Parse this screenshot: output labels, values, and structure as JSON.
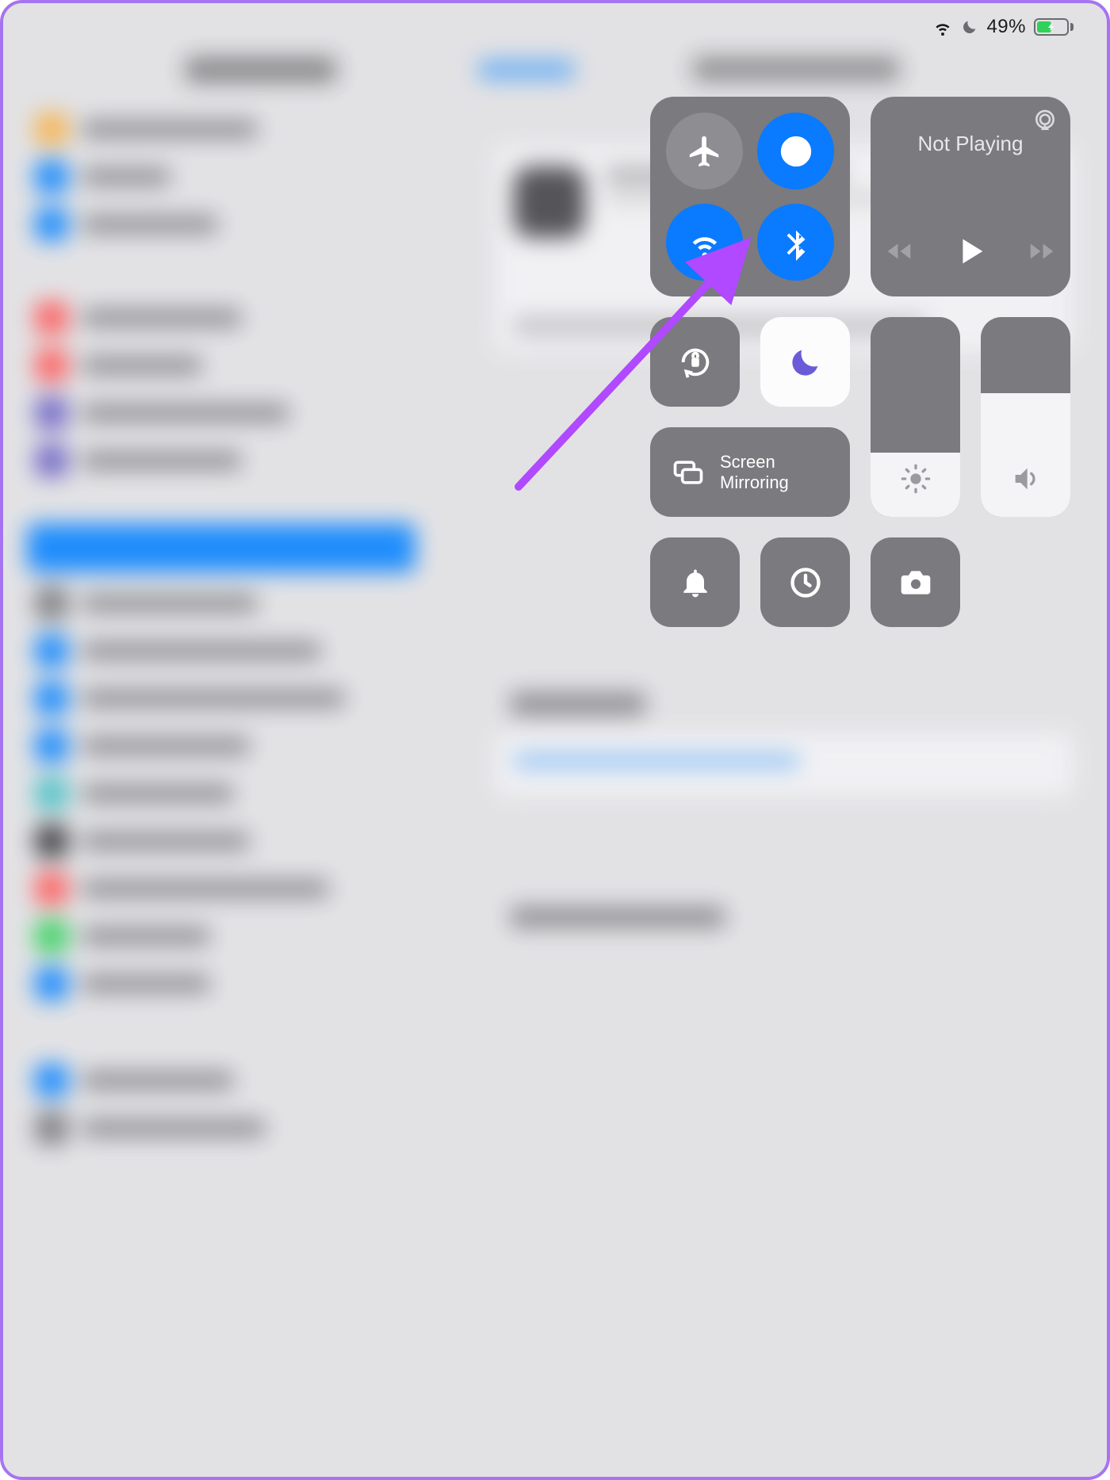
{
  "status_bar": {
    "battery_percent": "49%",
    "dnd_enabled": true,
    "wifi_connected": true,
    "charging": true
  },
  "control_center": {
    "connectivity": {
      "airplane": {
        "name": "airplane-mode",
        "on": false
      },
      "airdrop": {
        "name": "airdrop",
        "on": true
      },
      "wifi": {
        "name": "wifi",
        "on": true
      },
      "bluetooth": {
        "name": "bluetooth",
        "on": true
      }
    },
    "media": {
      "title": "Not Playing",
      "state": "paused"
    },
    "orientation_lock": {
      "on": false
    },
    "do_not_disturb": {
      "on": true
    },
    "screen_mirroring": {
      "label": "Screen\nMirroring"
    },
    "brightness": {
      "level_pct": 32
    },
    "volume": {
      "level_pct": 62
    },
    "shortcuts": {
      "notifications": "notifications",
      "timer": "timer",
      "camera": "camera"
    }
  },
  "annotation": {
    "arrow_target": "bluetooth-toggle",
    "arrow_color": "#b049ff"
  },
  "blurred_background": {
    "app": "Settings",
    "selected_sidebar_item": "General",
    "detail_title": "Software Update"
  }
}
